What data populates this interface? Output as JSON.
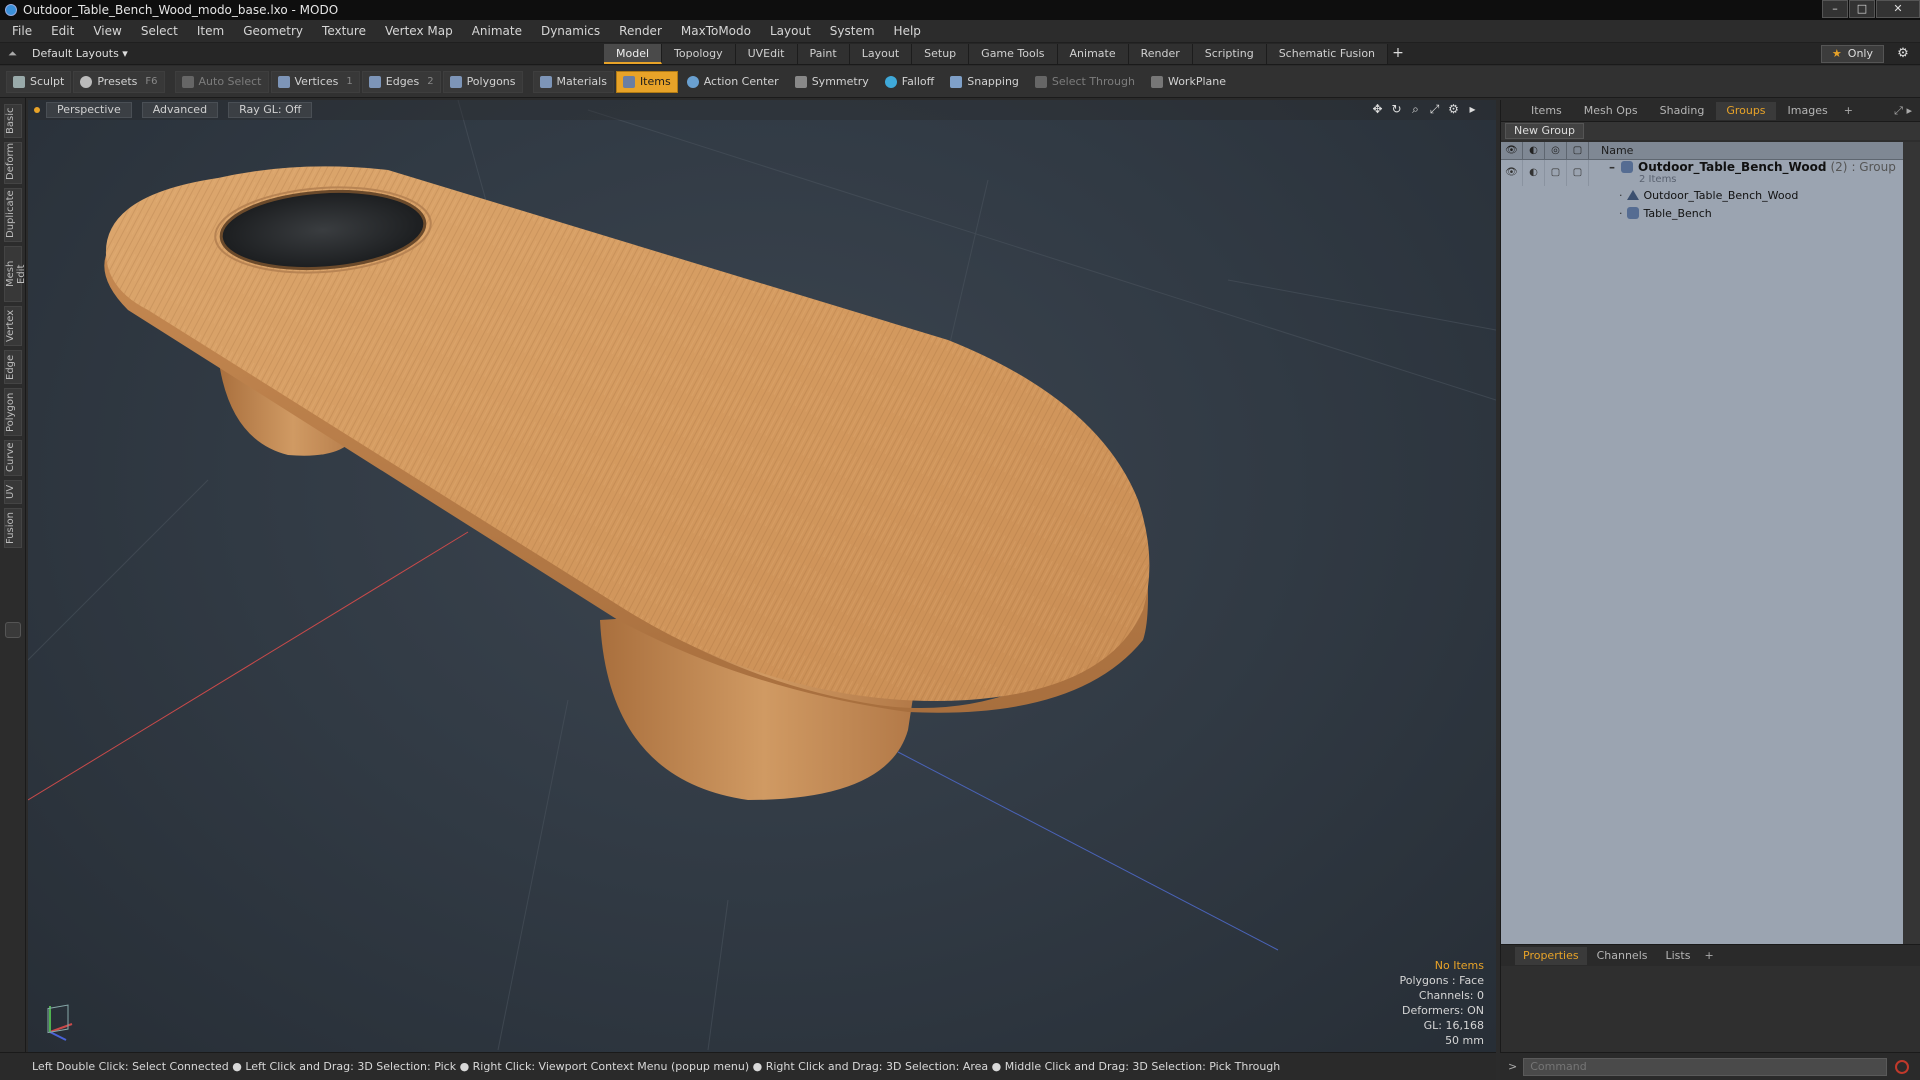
{
  "window": {
    "title": "Outdoor_Table_Bench_Wood_modo_base.lxo - MODO",
    "min": "–",
    "max": "□",
    "close": "✕"
  },
  "menu": [
    "File",
    "Edit",
    "View",
    "Select",
    "Item",
    "Geometry",
    "Texture",
    "Vertex Map",
    "Animate",
    "Dynamics",
    "Render",
    "MaxToModo",
    "Layout",
    "System",
    "Help"
  ],
  "layout": {
    "dropdown": "Default Layouts ▾",
    "tabs": [
      "Model",
      "Topology",
      "UVEdit",
      "Paint",
      "Layout",
      "Setup",
      "Game Tools",
      "Animate",
      "Render",
      "Scripting",
      "Schematic Fusion"
    ],
    "active_tab": "Model",
    "plus": "+",
    "only_label": "Only",
    "star": "★",
    "gear": "⚙"
  },
  "toolbar": {
    "sculpt": "Sculpt",
    "presets": "Presets",
    "presets_key": "F6",
    "auto_select": "Auto Select",
    "vertices": "Vertices",
    "vertices_key": "1",
    "edges": "Edges",
    "edges_key": "2",
    "polygons": "Polygons",
    "materials": "Materials",
    "items": "Items",
    "action_center": "Action Center",
    "symmetry": "Symmetry",
    "falloff": "Falloff",
    "snapping": "Snapping",
    "select_through": "Select Through",
    "workplane": "WorkPlane"
  },
  "left_tabs": [
    "Basic",
    "Deform",
    "Duplicate",
    "Mesh Edit",
    "Vertex",
    "Edge",
    "Polygon",
    "Curve",
    "UV",
    "Fusion"
  ],
  "viewport": {
    "perspective": "Perspective",
    "advanced": "Advanced",
    "raygl": "Ray GL: Off",
    "info": {
      "no_items": "No Items",
      "polygons": "Polygons : Face",
      "channels": "Channels: 0",
      "deformers": "Deformers: ON",
      "gl": "GL: 16,168",
      "size": "50 mm"
    }
  },
  "right_panel": {
    "tabs": [
      "Items",
      "Mesh Ops",
      "Shading",
      "Groups",
      "Images"
    ],
    "active_tab": "Groups",
    "plus": "+",
    "new_group": "New Group",
    "name_col": "Name",
    "group": {
      "name": "Outdoor_Table_Bench_Wood",
      "count": "(2)",
      "type": ": Group",
      "sub": "2 Items"
    },
    "children": [
      {
        "name": "Outdoor_Table_Bench_Wood",
        "icon": "mesh-icon"
      },
      {
        "name": "Table_Bench",
        "icon": "group-icon"
      }
    ],
    "props_tabs": [
      "Properties",
      "Channels",
      "Lists"
    ],
    "props_active": "Properties"
  },
  "status": "Left Double Click: Select Connected ● Left Click and Drag: 3D Selection: Pick ● Right Click: Viewport Context Menu (popup menu) ● Right Click and Drag: 3D Selection: Area ● Middle Click and Drag: 3D Selection: Pick Through",
  "command": {
    "placeholder": "Command",
    "arrow": ">"
  },
  "colors": {
    "accent": "#e8a328",
    "wood": "#d9a36a",
    "viewport_bg": "#313a44",
    "list_bg": "#9ba4b1"
  }
}
